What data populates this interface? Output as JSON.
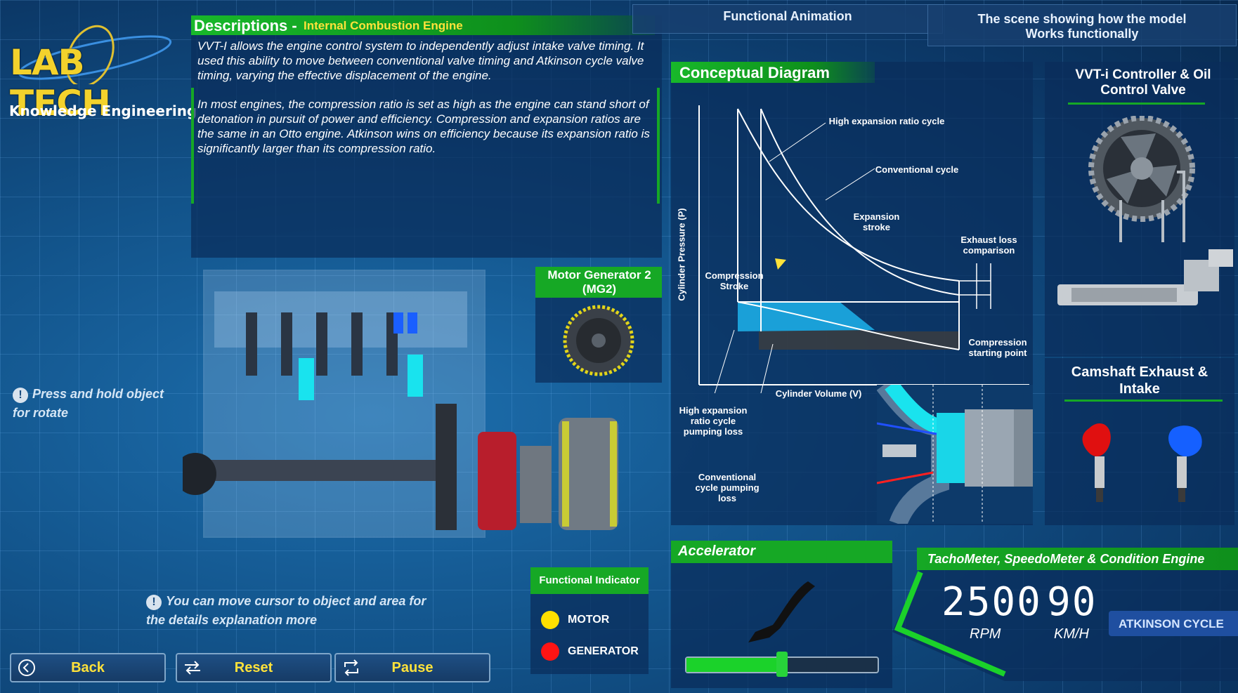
{
  "logo": {
    "text": "LAB TECH",
    "subtitle": "Knowledge Engineering"
  },
  "descriptions": {
    "title": "Descriptions -",
    "subtitle": "Internal Combustion Engine",
    "para1": "VVT-I allows the engine control system to independently adjust intake valve timing. It used this ability to move between conventional valve timing and Atkinson cycle valve timing, varying the effective displacement of the engine.",
    "para2": "In most engines, the compression ratio is set as high as the engine can stand short of detonation in pursuit of power and efficiency. Compression and expansion ratios are the same in an Otto engine. Atkinson wins on efficiency because its expansion ratio is significantly larger than its compression ratio."
  },
  "tabs": {
    "functional": "Functional Animation",
    "scene": "The scene showing how the model Works functionally"
  },
  "diagram": {
    "title": "Conceptual Diagram",
    "ylabel": "Cylinder Pressure (P)",
    "xlabel": "Cylinder Volume (V)",
    "labels": {
      "high_exp": "High expansion ratio cycle",
      "conventional": "Conventional cycle",
      "expansion": "Expansion stroke",
      "exhaust": "Exhaust loss comparison",
      "compression": "Compression Stroke",
      "comp_start": "Compression starting point",
      "high_pump": "High expansion ratio cycle pumping loss",
      "conv_pump": "Conventional cycle pumping loss"
    }
  },
  "vvti": {
    "title": "VVT-i Controller & Oil Control Valve"
  },
  "camshaft": {
    "title": "Camshaft Exhaust & Intake"
  },
  "mg2": {
    "title": "Motor Generator 2 (MG2)"
  },
  "indicator": {
    "title": "Functional Indicator",
    "items": [
      {
        "label": "MOTOR",
        "color": "#ffe000"
      },
      {
        "label": "GENERATOR",
        "color": "#ff1414"
      }
    ]
  },
  "accelerator": {
    "title": "Accelerator",
    "level": 0.5
  },
  "tacho": {
    "title": "TachoMeter, SpeedoMeter & Condition Engine",
    "rpm": "2500",
    "rpm_unit": "RPM",
    "speed": "90",
    "speed_unit": "KM/H",
    "cycle": "ATKINSON CYCLE"
  },
  "hints": {
    "rotate": "Press and hold object for rotate",
    "cursor": "You can move cursor to object and area for the details explanation more"
  },
  "buttons": {
    "back": "Back",
    "reset": "Reset",
    "pause": "Pause"
  },
  "colors": {
    "green": "#16a825",
    "yellow": "#ffe23a",
    "accent": "#18c8e0"
  }
}
